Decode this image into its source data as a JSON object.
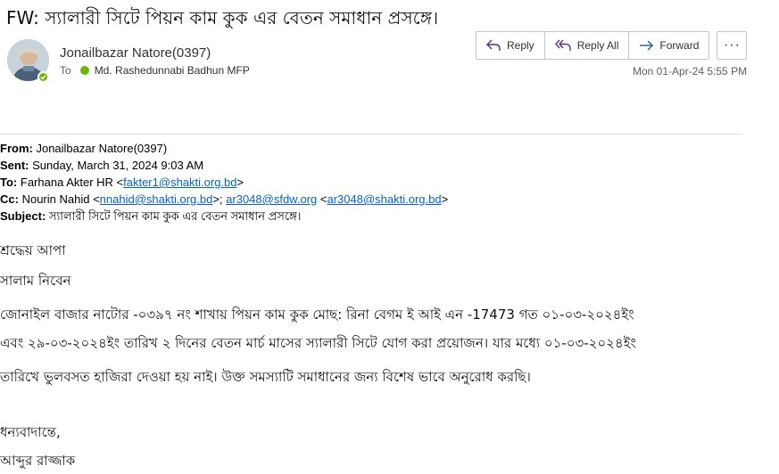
{
  "subject": "FW:  স্যালারী সিটে পিয়ন কাম কুক এর বেতন সমাধান প্রসঙ্গে।",
  "sender": {
    "name": "Jonailbazar Natore(0397)",
    "to_label": "To",
    "to_name": "Md. Rashedunnabi Badhun MFP"
  },
  "actions": {
    "reply": "Reply",
    "reply_all": "Reply All",
    "forward": "Forward",
    "more": "···"
  },
  "date": "Mon 01-Apr-24 5:55 PM",
  "headers": {
    "from_label": "From:",
    "from_value": "Jonailbazar Natore(0397)",
    "sent_label": "Sent:",
    "sent_value": "Sunday, March 31, 2024 9:03 AM",
    "to_label": "To:",
    "to_name": "Farhana Akter HR <",
    "to_email": "fakter1@shakti.org.bd",
    "to_close": ">",
    "cc_label": "Cc:",
    "cc_name1": "Nourin Nahid <",
    "cc_email1": "nnahid@shakti.org.bd",
    "cc_sep1": ">; ",
    "cc_email2": "ar3048@sfdw.org",
    "cc_sep2": " <",
    "cc_email3": "ar3048@shakti.org.bd",
    "cc_close": ">",
    "subject_label": "Subject:",
    "subject_value": "স্যালারী সিটে পিয়ন কাম কুক এর বেতন সমাধান প্রসঙ্গে।"
  },
  "body": {
    "salutation": "শ্রদ্ধেয় আপা",
    "greeting": "সালাম নিবেন",
    "para1": "জোনাইল বাজার  নাটোর -০৩৯৭ নং শাখায় পিয়ন কাম কুক মোছ: রিনা বেগম  ই আই এন -17473 গত  ০১-০৩-২০২৪ইং",
    "para2": "এবং ২৯-০৩-২০২৪ইং তারিখ ২ দিনের বেতন মার্চ মাসের স্যালারী সিটে যোগ করা প্রয়োজন। যার মধ্যে ০১-০৩-২০২৪ইং",
    "para3": "তারিখে ভুলবসত হাজিরা দেওয়া হয় নাই।  উক্ত সমস্যাটি  সমাধানের জন্য বিশেষ ভাবে অনুরোধ করছি।",
    "closing": "ধন্যবাদান্তে,",
    "signature": "আব্দুর রাজ্জাক"
  }
}
